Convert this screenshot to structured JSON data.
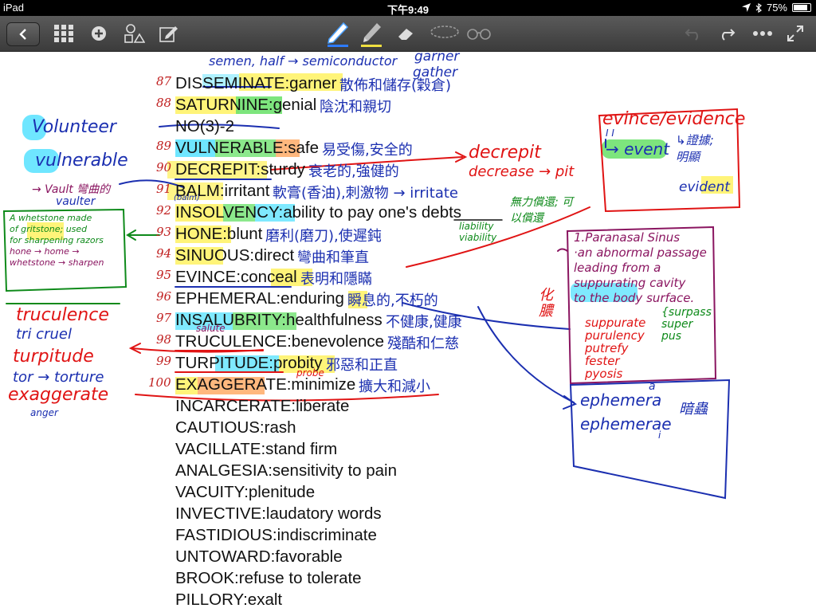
{
  "status": {
    "device": "iPad",
    "time": "下午9:49",
    "battery": "75%",
    "battery_level": 0.75
  },
  "toolbar": {
    "left_icons": [
      "back-icon",
      "grid-icon",
      "add-icon",
      "shapes-icon",
      "edit-icon"
    ],
    "tools": [
      "pen-icon",
      "highlighter-icon",
      "eraser-icon",
      "lasso-icon",
      "glasses-icon"
    ],
    "right_icons": [
      "undo-icon",
      "redo-icon",
      "more-icon",
      "fullscreen-icon"
    ]
  },
  "items": [
    {
      "num": "87",
      "text": "DISSEMINATE:garner",
      "note": "散佈和儲存(穀倉)"
    },
    {
      "num": "88",
      "text": "SATURNINE:genial",
      "note": "陰沈和親切"
    },
    {
      "num": "",
      "text": "NO(3)-2",
      "note": ""
    },
    {
      "num": "89",
      "text": "VULNERABLE:safe",
      "note": "易受傷,安全的"
    },
    {
      "num": "90",
      "text": "DECREPIT:sturdy",
      "note": "衰老的,強健的"
    },
    {
      "num": "91",
      "text": "BALM:irritant",
      "note": "軟膏(香油),刺激物 → irritate"
    },
    {
      "num": "92",
      "text": "INSOLVENCY:ability to pay one's debts",
      "note": ""
    },
    {
      "num": "93",
      "text": "HONE:blunt",
      "note": "磨利(磨刀),使遲鈍"
    },
    {
      "num": "94",
      "text": "SINUOUS:direct",
      "note": "彎曲和筆直"
    },
    {
      "num": "95",
      "text": "EVINCE:conceal",
      "note": "表明和隱瞞"
    },
    {
      "num": "96",
      "text": "EPHEMERAL:enduring",
      "note": "瞬息的,不朽的"
    },
    {
      "num": "97",
      "text": "INSALUBRITY:healthfulness",
      "note": "不健康,健康"
    },
    {
      "num": "98",
      "text": "TRUCULENCE:benevolence",
      "note": "殘酷和仁慈"
    },
    {
      "num": "99",
      "text": "TURPITUDE:probity",
      "note": "邪惡和正直"
    },
    {
      "num": "100",
      "text": "EXAGGERATE:minimize",
      "note": "擴大和減小"
    },
    {
      "num": "",
      "text": "INCARCERATE:liberate",
      "note": ""
    },
    {
      "num": "",
      "text": "CAUTIOUS:rash",
      "note": ""
    },
    {
      "num": "",
      "text": "VACILLATE:stand firm",
      "note": ""
    },
    {
      "num": "",
      "text": "ANALGESIA:sensitivity to pain",
      "note": ""
    },
    {
      "num": "",
      "text": "VACUITY:plenitude",
      "note": ""
    },
    {
      "num": "",
      "text": "INVECTIVE:laudatory words",
      "note": ""
    },
    {
      "num": "",
      "text": "FASTIDIOUS:indiscriminate",
      "note": ""
    },
    {
      "num": "",
      "text": "UNTOWARD:favorable",
      "note": ""
    },
    {
      "num": "",
      "text": "BROOK:refuse to tolerate",
      "note": ""
    },
    {
      "num": "",
      "text": "PILLORY:exalt",
      "note": ""
    }
  ],
  "annotations": {
    "semen": "semen, half → semiconductor",
    "garner": "garner",
    "gather": "gather",
    "volunteer": "Volunteer",
    "vulnerable": "vulnerable",
    "vault": "→ Vault 彎曲的",
    "vaulter": "vaulter",
    "decrepit": "decrepit",
    "decrease": "decrease → pit",
    "balm_small": "(balm)",
    "insolvency_note": "無力償還; 可以償還",
    "liability": "liability",
    "viability": "viability",
    "whetstone": [
      "A whetstone made",
      "of gritstone; used",
      "for sharpening razors",
      "hone → home →",
      "whetstone → sharpen"
    ],
    "evince_box": {
      "title": "evince/evidence",
      "ei": "I I",
      "event": "→ event",
      "cn": "↳證據; 明顯",
      "arrow": "↳",
      "evident": "evident"
    },
    "sinus_box": [
      "1.Paranasal Sinus",
      "·an abnormal passage",
      "leading from a",
      "suppurating cavity",
      "to the body surface."
    ],
    "pus_words": [
      "suppurate",
      "purulency",
      "putrefy",
      "fester",
      "pyosis"
    ],
    "pus_green": [
      "{surpass",
      "super",
      "pus"
    ],
    "hua": "化膿",
    "ephem_box": [
      "ephemera",
      "ephemerae",
      "暗蟲"
    ],
    "ephem_a": "a",
    "ephem_i": "i",
    "truculence": "truculence",
    "tri_cruel": "tri cruel",
    "turpitude": "turpitude",
    "torture": "tor → torture",
    "exaggerate": "exaggerate",
    "anger": "anger",
    "salute": "salute",
    "probe": "probe"
  },
  "colors": {
    "blue_ink": "#1b2fb0",
    "red_ink": "#e01414",
    "green_ink": "#0e8a1a",
    "purple_ink": "#8a1560",
    "yellow_hl": "#fff36a",
    "cyan_hl": "#5fe3ff"
  }
}
